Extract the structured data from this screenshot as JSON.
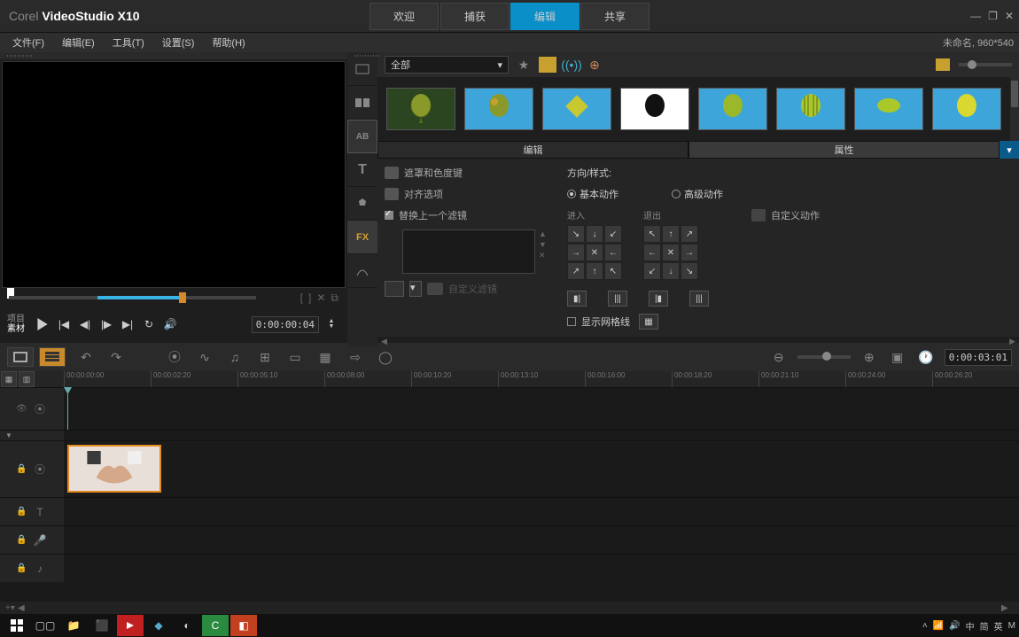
{
  "app": {
    "brand": "Corel",
    "product": "VideoStudio",
    "version": "X10"
  },
  "win_controls": {
    "minimize": "—",
    "restore": "❐",
    "close": "✕"
  },
  "top_tabs": {
    "t0": "欢迎",
    "t1": "捕获",
    "t2": "编辑",
    "t3": "共享"
  },
  "menus": {
    "file": "文件(F)",
    "edit": "编辑(E)",
    "tools": "工具(T)",
    "settings": "设置(S)",
    "help": "帮助(H)"
  },
  "file_info": "未命名, 960*540",
  "preview": {
    "project": "项目",
    "clip": "素材",
    "timecode": "0:00:00:04",
    "mark_in": "[",
    "mark_out": "]",
    "cut": "✕",
    "copy": "⧉"
  },
  "library": {
    "category": "全部",
    "dd_arrow": "▾"
  },
  "prop_tabs": {
    "edit": "编辑",
    "attr": "属性"
  },
  "props": {
    "mask": "遮罩和色度键",
    "align": "对齐选项",
    "replace": "替换上一个滤镜",
    "custom_filter": "自定义滤镜",
    "direction": "方向/样式:",
    "basic": "基本动作",
    "advanced": "高级动作",
    "enter": "进入",
    "exit": "退出",
    "custom_action": "自定义动作",
    "show_grid": "显示网格线"
  },
  "ruler": {
    "t0": "00:00:00:00",
    "t1": "00:00:02:20",
    "t2": "00:00:05:10",
    "t3": "00:00:08:00",
    "t4": "00:00:10:20",
    "t5": "00:00:13:10",
    "t6": "00:00:16:00",
    "t7": "00:00:18:20",
    "t8": "00:00:21:10",
    "t9": "00:00:24:00",
    "t10": "00:00:26:20"
  },
  "tl": {
    "duration": "0:00:03:01"
  },
  "tray": {
    "ime1": "中",
    "ime2": "简",
    "ime3": "英",
    "ime4": "M"
  }
}
